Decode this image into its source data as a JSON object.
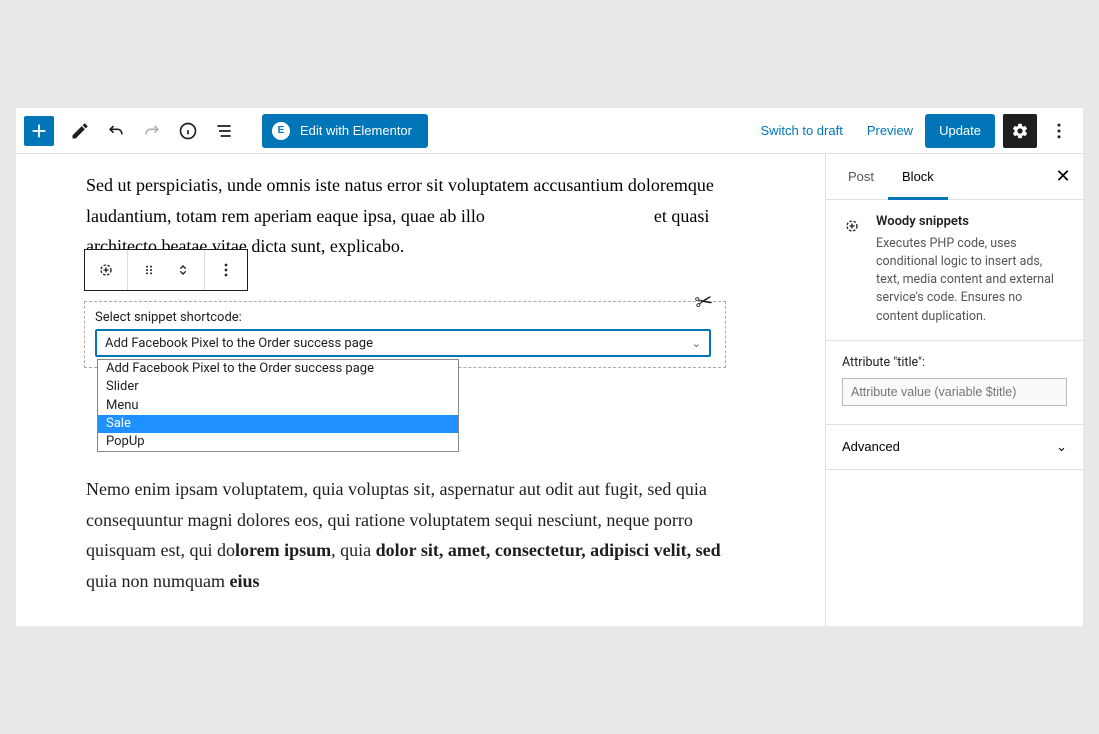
{
  "toolbar": {
    "elementor_label": "Edit with Elementor",
    "elementor_icon_text": "E",
    "switch_to_draft": "Switch to draft",
    "preview": "Preview",
    "update": "Update"
  },
  "editor": {
    "para1_a": "Sed ut perspiciatis, unde omnis iste natus error sit voluptatem accusantium doloremque laudantium, totam rem aperiam eaque ipsa, quae ab illo",
    "para1_b": "et quasi architecto beatae vitae dicta sunt, explicabo.",
    "para2_a": "Nemo enim ipsam voluptatem, quia voluptas sit, aspernatur aut odit aut fugit, sed quia consequuntur magni dolores eos, qui ratione voluptatem sequi nesciunt, neque porro quisquam est, qui do",
    "para2_b": "lorem ipsum",
    "para2_c": ", quia ",
    "para2_d": "dolor sit, amet, consectetur, adipisci velit, sed",
    "para2_e": " quia non numquam ",
    "para2_f": "eius"
  },
  "snippet": {
    "label": "Select snippet shortcode:",
    "selected": "Add Facebook Pixel to the Order success page",
    "options": [
      "Add Facebook Pixel to the Order success page",
      "Slider",
      "Menu",
      "Sale",
      "PopUp"
    ],
    "highlight_index": 3
  },
  "sidebar": {
    "tabs": {
      "post": "Post",
      "block": "Block"
    },
    "block": {
      "title": "Woody snippets",
      "desc": "Executes PHP code, uses conditional logic to insert ads, text, media content and external service's code. Ensures no content duplication."
    },
    "attr": {
      "label": "Attribute \"title\":",
      "placeholder": "Attribute value (variable $title)"
    },
    "advanced": "Advanced"
  }
}
